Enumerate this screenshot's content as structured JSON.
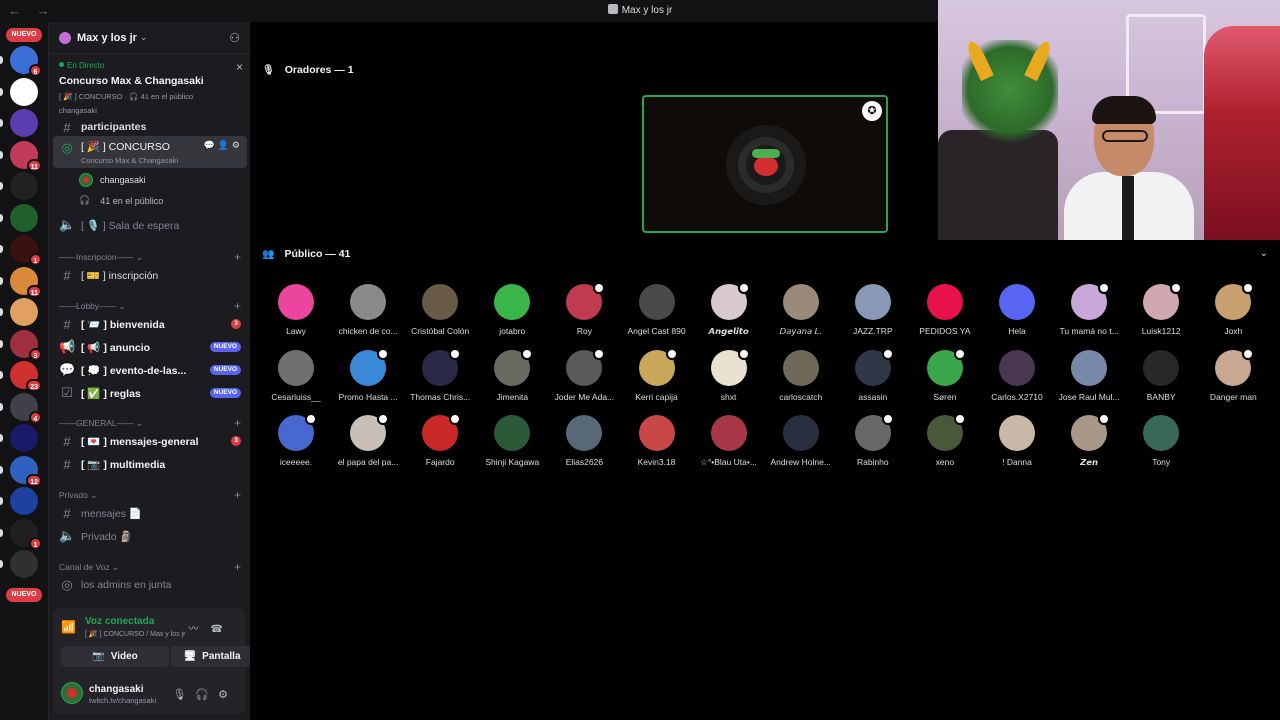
{
  "window": {
    "title": "Max y los jr",
    "nav_arrows": "← →"
  },
  "rail": {
    "nuevo_top": "NUEVO",
    "nuevo_bottom": "NUEVO",
    "servers": [
      {
        "badge": "6",
        "color": "#3a6fd8"
      },
      {
        "badge": "",
        "color": "#ffffff"
      },
      {
        "badge": "",
        "color": "#5b3fb0"
      },
      {
        "badge": "11",
        "color": "#c23a5a"
      },
      {
        "badge": "",
        "color": "#222222"
      },
      {
        "badge": "",
        "color": "#1f5f2a"
      },
      {
        "badge": "1",
        "color": "#3a1010"
      },
      {
        "badge": "11",
        "color": "#d88a3a"
      },
      {
        "badge": "",
        "color": "#e0a060"
      },
      {
        "badge": "3",
        "color": "#a03040"
      },
      {
        "badge": "23",
        "color": "#d03030"
      },
      {
        "badge": "4",
        "color": "#404048"
      },
      {
        "badge": "",
        "color": "#1a1a6a"
      },
      {
        "badge": "12",
        "color": "#3060c0"
      },
      {
        "badge": "",
        "color": "#2040a0"
      },
      {
        "badge": "1",
        "color": "#202020"
      },
      {
        "badge": "",
        "color": "#303030"
      }
    ]
  },
  "sidebar": {
    "server_name": "Max y los jr",
    "live": {
      "tag": "En Directo",
      "title": "Concurso Max & Changasaki",
      "meta": "[ 🎉 ] CONCURSO · 🎧 41 en el público",
      "user": "changasaki"
    },
    "partial_item": "participantes",
    "stage_channel": {
      "label": "[ 🎉 ] CONCURSO",
      "subtitle": "Concurso Max & Changasaki"
    },
    "stage_user": "changasaki",
    "stage_audience": "41 en el público",
    "waiting_room": "[ 🎙️ ] Sala de espera",
    "categories": {
      "inscripcion": "——Inscripcion——",
      "lobby": "——Lobby——",
      "general": "——GENERAL——",
      "privado": "Privado",
      "canal_voz": "Canal de Voz"
    },
    "channels": {
      "inscripcion": "[ 🎫 ] inscripción",
      "bienvenida": "[ 📨 ] bienvenida",
      "bienvenida_badge": "3",
      "anuncio": "[ 📢 ] anuncio",
      "anuncio_badge": "NUEVO",
      "evento": "[ 💭 ] evento-de-las...",
      "evento_badge": "NUEVO",
      "reglas": "[ ✅ ] reglas",
      "reglas_badge": "NUEVO",
      "mensajes_general": "[ 💌 ] mensajes-general",
      "mensajes_general_badge": "3",
      "multimedia": "[ 📷 ] multimedia",
      "mensajes": "mensajes 📄",
      "privado": "Privado 🗿",
      "admins": "los admins en junta"
    }
  },
  "voice_panel": {
    "status": "Voz conectada",
    "sub": "[ 🎉 ] CONCURSO / Max y los jr",
    "video_label": "Video",
    "screen_label": "Pantalla"
  },
  "user": {
    "name": "changasaki",
    "status": "twitch.tv/changasaki"
  },
  "stage": {
    "speakers_heading": "Oradores — 1",
    "audience_heading": "Público — 41",
    "audience": [
      {
        "name": "Lawy",
        "color": "#eb459e",
        "status": false
      },
      {
        "name": "chicken de co...",
        "color": "#8a8a88",
        "status": false
      },
      {
        "name": "Cristóbal Colón",
        "color": "#6a5a48",
        "status": false
      },
      {
        "name": "jotabro",
        "color": "#39b54a",
        "status": false
      },
      {
        "name": "Roy",
        "color": "#c03a50",
        "status": true
      },
      {
        "name": "Angel Cast 890",
        "color": "#4a4a4a",
        "status": false
      },
      {
        "name": "𝘼𝙣𝙜𝙚𝙡𝙞𝙩𝙤",
        "color": "#d8c8d0",
        "status": true
      },
      {
        "name": "𝘋𝘢𝘺𝘢𝘯𝘢 𝘓.",
        "color": "#9a8a7a",
        "status": false
      },
      {
        "name": "JAZZ.TRP",
        "color": "#8a98b8",
        "status": false
      },
      {
        "name": "PEDIDOS YA",
        "color": "#e8114b",
        "status": false
      },
      {
        "name": "Hela",
        "color": "#5865f2",
        "status": false
      },
      {
        "name": "Tu mamá no t...",
        "color": "#c8a8d8",
        "status": true
      },
      {
        "name": "Luisk1212",
        "color": "#d0a8b0",
        "status": true
      },
      {
        "name": "Joxh",
        "color": "#c8a070",
        "status": true
      },
      {
        "name": "Cesarluiss__",
        "color": "#707070",
        "status": false
      },
      {
        "name": "Promo Hasta ...",
        "color": "#3a8ad8",
        "status": true
      },
      {
        "name": "Thomas Chris...",
        "color": "#2a2a48",
        "status": true
      },
      {
        "name": "Jimenita",
        "color": "#6a6a60",
        "status": true
      },
      {
        "name": "Joder Me Ada...",
        "color": "#5a5a5a",
        "status": true
      },
      {
        "name": "Kerri capija",
        "color": "#c8a858",
        "status": true
      },
      {
        "name": "shxt",
        "color": "#e8e0d0",
        "status": true
      },
      {
        "name": "carloscatch",
        "color": "#706858",
        "status": false
      },
      {
        "name": "assasin",
        "color": "#303848",
        "status": true
      },
      {
        "name": "Søren",
        "color": "#3aa84a",
        "status": true
      },
      {
        "name": "Carlos.X2710",
        "color": "#4a3850",
        "status": false
      },
      {
        "name": "Jose Raul Mul...",
        "color": "#7888a8",
        "status": false
      },
      {
        "name": "BANBY",
        "color": "#282828",
        "status": false
      },
      {
        "name": "Danger man",
        "color": "#c8a890",
        "status": true
      },
      {
        "name": "iceeeee.",
        "color": "#4868d0",
        "status": true
      },
      {
        "name": "el papa del pa...",
        "color": "#c8c0b8",
        "status": true
      },
      {
        "name": "Fajardo",
        "color": "#c82828",
        "status": true
      },
      {
        "name": "Shinji Kagawa",
        "color": "#2a5a3a",
        "status": false
      },
      {
        "name": "Elias2626",
        "color": "#586878",
        "status": false
      },
      {
        "name": "Kevin3.18",
        "color": "#c84848",
        "status": false
      },
      {
        "name": "☆°•Blau Uta•...",
        "color": "#a83848",
        "status": false
      },
      {
        "name": "Andrew Holne...",
        "color": "#283040",
        "status": false
      },
      {
        "name": "Rabinho",
        "color": "#686868",
        "status": true
      },
      {
        "name": "xeno",
        "color": "#485838",
        "status": true
      },
      {
        "name": "! Danna",
        "color": "#c8b8a8",
        "status": false
      },
      {
        "name": "𝙕𝙚𝙣",
        "color": "#a89888",
        "status": true
      },
      {
        "name": "Tony",
        "color": "#386858",
        "status": false
      }
    ]
  }
}
